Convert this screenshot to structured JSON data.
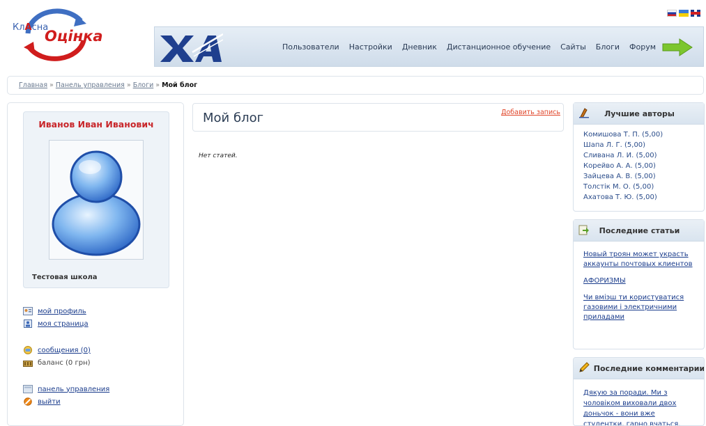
{
  "header": {
    "logo_prefix_1": "Кл",
    "logo_prefix_2": "А",
    "logo_prefix_3": "сна",
    "logo_main": "Оцінка",
    "languages": [
      "ru",
      "ua",
      "gb"
    ],
    "nav": [
      "Пользователи",
      "Настройки",
      "Дневник",
      "Дистанционное обучение",
      "Сайты",
      "Блоги",
      "Форум"
    ]
  },
  "breadcrumb": {
    "items": [
      "Главная",
      "Панель управления",
      "Блоги"
    ],
    "separator": "»",
    "current": "Мой блог"
  },
  "user": {
    "name": "Иванов Иван Иванович",
    "school": "Тестовая школа"
  },
  "user_links": {
    "profile": "мой профиль",
    "page": "моя страница",
    "messages": "сообщения (0)",
    "balance": "баланс (0 грн)",
    "control_panel": "панель управления",
    "logout": "выйти"
  },
  "main": {
    "title": "Мой блог",
    "add_post": "Добавить запись",
    "empty": "Нет статей."
  },
  "best_authors": {
    "title": "Лучшие авторы",
    "items": [
      "Комишова Т. П. (5,00)",
      "Шапа Л. Г. (5,00)",
      "Сливана Л. И. (5,00)",
      "Корейво А. А. (5,00)",
      "Зайцева А. В. (5,00)",
      "Толстік М. О. (5,00)",
      "Ахатова Т. Ю. (5,00)"
    ]
  },
  "latest_articles": {
    "title": "Последние статьи",
    "items": [
      "Новый троян может украсть аккаунты почтовых клиентов",
      "АФОРИЗМЫ",
      "Чи вміэш ти користуватися газовими і электричними приладами"
    ]
  },
  "latest_comments": {
    "title": "Последние комментарии",
    "text": "Дякую за поради. Ми з чоловіком виховали двох доньчок - вони вже студентки, гарно вчаться."
  },
  "colors": {
    "accent_red": "#c8262a",
    "link": "#1a3c8c",
    "nav_bg": "#dbe5ef"
  }
}
